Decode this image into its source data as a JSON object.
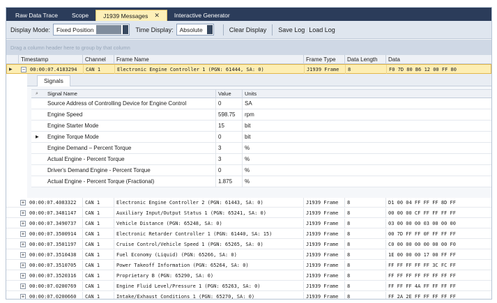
{
  "tabs": [
    {
      "label": "Raw Data Trace",
      "active": false
    },
    {
      "label": "Scope",
      "active": false
    },
    {
      "label": "J1939 Messages",
      "active": true,
      "close": "✕"
    },
    {
      "label": "Interactive Generator",
      "active": false
    }
  ],
  "toolbar": {
    "display_mode_label": "Display Mode:",
    "display_mode_value": "Fixed Position",
    "time_display_label": "Time Display:",
    "time_display_value": "Absolute",
    "clear_display": "Clear Display",
    "save_log": "Save Log",
    "load_log": "Load Log"
  },
  "group_panel_text": "Drag a column header here to group by that column",
  "columns": [
    "Timestamp",
    "Channel",
    "Frame Name",
    "Frame Type",
    "Data Length",
    "Data"
  ],
  "selected_row": {
    "timestamp": "00:00:07.4183294",
    "channel": "CAN 1",
    "frame_name": "Electronic Engine Controller 1 (PGN: 61444, SA: 0)",
    "frame_type": "J1939 Frame",
    "data_length": "8",
    "data": "F0 7D 80 B6 12 00 FF 80",
    "expander": "−"
  },
  "detail": {
    "tab": "Signals",
    "columns": [
      "Signal Name",
      "Value",
      "Units"
    ],
    "signals": [
      {
        "name": "Source Address of Controlling Device for Engine Control",
        "value": "0",
        "units": "SA"
      },
      {
        "name": "Engine Speed",
        "value": "598.75",
        "units": "rpm"
      },
      {
        "name": "Engine Starter Mode",
        "value": "15",
        "units": "bit"
      },
      {
        "name": "Engine Torque Mode",
        "value": "0",
        "units": "bit"
      },
      {
        "name": "Engine Demand – Percent Torque",
        "value": "3",
        "units": "%"
      },
      {
        "name": "Actual Engine - Percent Torque",
        "value": "3",
        "units": "%"
      },
      {
        "name": "Driver's Demand Engine - Percent Torque",
        "value": "0",
        "units": "%"
      },
      {
        "name": "Actual Engine - Percent Torque (Fractional)",
        "value": "1.875",
        "units": "%"
      }
    ]
  },
  "rows": [
    {
      "expander": "+",
      "timestamp": "00:00:07.4083322",
      "channel": "CAN 1",
      "frame_name": "Electronic Engine Controller 2 (PGN: 61443, SA: 0)",
      "frame_type": "J1939 Frame",
      "data_length": "8",
      "data": "D1 00 04 FF FF FF 8D FF"
    },
    {
      "expander": "+",
      "timestamp": "00:00:07.3481147",
      "channel": "CAN 1",
      "frame_name": "Auxiliary Input/Output Status 1 (PGN: 65241, SA: 0)",
      "frame_type": "J1939 Frame",
      "data_length": "8",
      "data": "00 00 00 CF FF FF FF FF"
    },
    {
      "expander": "+",
      "timestamp": "00:00:07.3490737",
      "channel": "CAN 1",
      "frame_name": "Vehicle Distance (PGN: 65248, SA: 0)",
      "frame_type": "J1939 Frame",
      "data_length": "8",
      "data": "03 00 00 00 03 00 00 00"
    },
    {
      "expander": "+",
      "timestamp": "00:00:07.3500914",
      "channel": "CAN 1",
      "frame_name": "Electronic Retarder Controller 1 (PGN: 61440, SA: 15)",
      "frame_type": "J1939 Frame",
      "data_length": "8",
      "data": "00 7D FF FF 0F FF FF FF"
    },
    {
      "expander": "+",
      "timestamp": "00:00:07.3501197",
      "channel": "CAN 1",
      "frame_name": "Cruise Control/Vehicle Speed 1 (PGN: 65265, SA: 0)",
      "frame_type": "J1939 Frame",
      "data_length": "8",
      "data": "C0 00 00 00 00 00 00 F0"
    },
    {
      "expander": "+",
      "timestamp": "00:00:07.3510438",
      "channel": "CAN 1",
      "frame_name": "Fuel Economy (Liquid) (PGN: 65266, SA: 0)",
      "frame_type": "J1939 Frame",
      "data_length": "8",
      "data": "1E 00 00 00 17 00 FF FF"
    },
    {
      "expander": "+",
      "timestamp": "00:00:07.3510705",
      "channel": "CAN 1",
      "frame_name": "Power Takeoff Information (PGN: 65264, SA: 0)",
      "frame_type": "J1939 Frame",
      "data_length": "8",
      "data": "FF FF FF FF FF 3C FC FF"
    },
    {
      "expander": "+",
      "timestamp": "00:00:07.3520316",
      "channel": "CAN 1",
      "frame_name": "Proprietary B (PGN: 65290, SA: 0)",
      "frame_type": "J1939 Frame",
      "data_length": "8",
      "data": "FF FF FF FF FF FF FF FF"
    },
    {
      "expander": "+",
      "timestamp": "00:00:07.0200769",
      "channel": "CAN 1",
      "frame_name": "Engine Fluid Level/Pressure 1 (PGN: 65263, SA: 0)",
      "frame_type": "J1939 Frame",
      "data_length": "8",
      "data": "FF FF FF 4A FF FF FF FF"
    },
    {
      "expander": "+",
      "timestamp": "00:00:07.0200660",
      "channel": "CAN 1",
      "frame_name": "Intake/Exhaust Conditions 1 (PGN: 65270, SA: 0)",
      "frame_type": "J1939 Frame",
      "data_length": "8",
      "data": "FF 2A 2E FF FF FF FF FF"
    }
  ],
  "colors": {
    "tabstrip": "#2b3c5a",
    "active_tab": "#fdf0b8",
    "selected_row": "#fdeeb3",
    "toolbar": "#dfe6ef"
  },
  "icons": {
    "row_indicator": "▶",
    "detail_search": "🔍"
  }
}
